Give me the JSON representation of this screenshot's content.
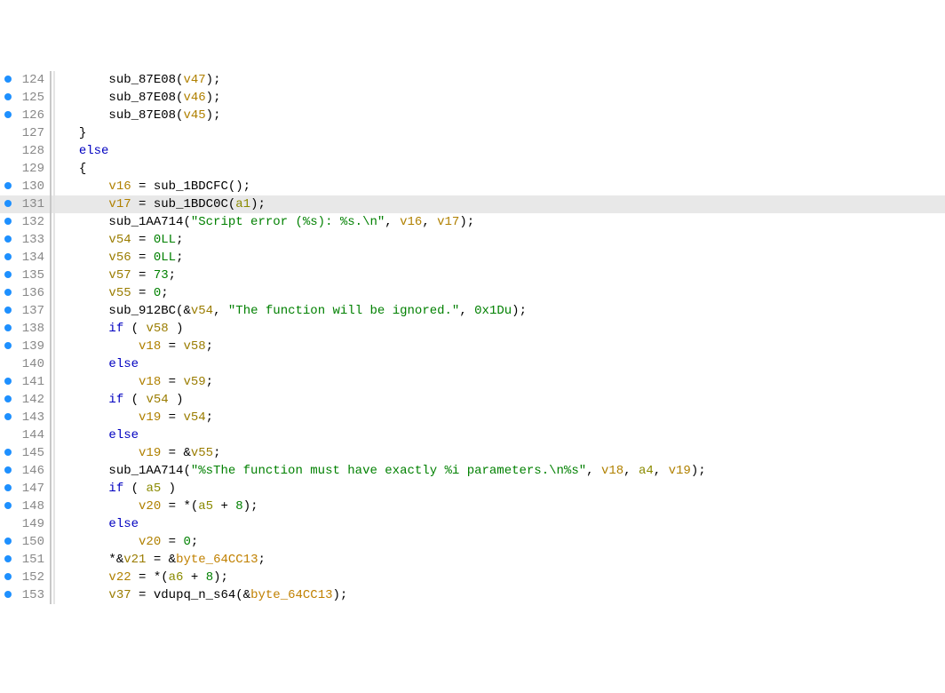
{
  "lines": [
    {
      "n": 124,
      "bp": true,
      "indent": 3,
      "tokens": [
        {
          "t": "sub_87E08",
          "c": "fn"
        },
        {
          "t": "("
        },
        {
          "t": "v47",
          "c": "var2"
        },
        {
          "t": ");"
        }
      ]
    },
    {
      "n": 125,
      "bp": true,
      "indent": 3,
      "tokens": [
        {
          "t": "sub_87E08",
          "c": "fn"
        },
        {
          "t": "("
        },
        {
          "t": "v46",
          "c": "var2"
        },
        {
          "t": ");"
        }
      ]
    },
    {
      "n": 126,
      "bp": true,
      "indent": 3,
      "tokens": [
        {
          "t": "sub_87E08",
          "c": "fn"
        },
        {
          "t": "("
        },
        {
          "t": "v45",
          "c": "var2"
        },
        {
          "t": ");"
        }
      ]
    },
    {
      "n": 127,
      "bp": false,
      "indent": 1,
      "tokens": [
        {
          "t": "}"
        }
      ]
    },
    {
      "n": 128,
      "bp": false,
      "indent": 1,
      "tokens": [
        {
          "t": "else",
          "c": "kw"
        }
      ]
    },
    {
      "n": 129,
      "bp": false,
      "indent": 1,
      "tokens": [
        {
          "t": "{"
        }
      ]
    },
    {
      "n": 130,
      "bp": true,
      "indent": 3,
      "tokens": [
        {
          "t": "v16",
          "c": "var2"
        },
        {
          "t": " = "
        },
        {
          "t": "sub_1BDCFC",
          "c": "fn"
        },
        {
          "t": "();"
        }
      ]
    },
    {
      "n": 131,
      "bp": true,
      "indent": 3,
      "hl": true,
      "tokens": [
        {
          "t": "v17",
          "c": "var2"
        },
        {
          "t": " = "
        },
        {
          "t": "sub_1BDC0C",
          "c": "fn"
        },
        {
          "t": "("
        },
        {
          "t": "a1",
          "c": "param"
        },
        {
          "t": ");"
        }
      ]
    },
    {
      "n": 132,
      "bp": true,
      "indent": 3,
      "tokens": [
        {
          "t": "sub_1AA714",
          "c": "fn"
        },
        {
          "t": "("
        },
        {
          "t": "\"Script error (%s): %s.\\n\"",
          "c": "str"
        },
        {
          "t": ", "
        },
        {
          "t": "v16",
          "c": "var2"
        },
        {
          "t": ", "
        },
        {
          "t": "v17",
          "c": "var2"
        },
        {
          "t": ");"
        }
      ]
    },
    {
      "n": 133,
      "bp": true,
      "indent": 3,
      "tokens": [
        {
          "t": "v54",
          "c": "var"
        },
        {
          "t": " = "
        },
        {
          "t": "0LL",
          "c": "num"
        },
        {
          "t": ";"
        }
      ]
    },
    {
      "n": 134,
      "bp": true,
      "indent": 3,
      "tokens": [
        {
          "t": "v56",
          "c": "var"
        },
        {
          "t": " = "
        },
        {
          "t": "0LL",
          "c": "num"
        },
        {
          "t": ";"
        }
      ]
    },
    {
      "n": 135,
      "bp": true,
      "indent": 3,
      "tokens": [
        {
          "t": "v57",
          "c": "var"
        },
        {
          "t": " = "
        },
        {
          "t": "73",
          "c": "num"
        },
        {
          "t": ";"
        }
      ]
    },
    {
      "n": 136,
      "bp": true,
      "indent": 3,
      "tokens": [
        {
          "t": "v55",
          "c": "var"
        },
        {
          "t": " = "
        },
        {
          "t": "0",
          "c": "num"
        },
        {
          "t": ";"
        }
      ]
    },
    {
      "n": 137,
      "bp": true,
      "indent": 3,
      "tokens": [
        {
          "t": "sub_912BC",
          "c": "fn"
        },
        {
          "t": "(&"
        },
        {
          "t": "v54",
          "c": "var"
        },
        {
          "t": ", "
        },
        {
          "t": "\"The function will be ignored.\"",
          "c": "str"
        },
        {
          "t": ", "
        },
        {
          "t": "0x1Du",
          "c": "num"
        },
        {
          "t": ");"
        }
      ]
    },
    {
      "n": 138,
      "bp": true,
      "indent": 3,
      "tokens": [
        {
          "t": "if",
          "c": "kw"
        },
        {
          "t": " ( "
        },
        {
          "t": "v58",
          "c": "var"
        },
        {
          "t": " )"
        }
      ]
    },
    {
      "n": 139,
      "bp": true,
      "indent": 5,
      "tokens": [
        {
          "t": "v18",
          "c": "var2"
        },
        {
          "t": " = "
        },
        {
          "t": "v58",
          "c": "var"
        },
        {
          "t": ";"
        }
      ]
    },
    {
      "n": 140,
      "bp": false,
      "indent": 3,
      "tokens": [
        {
          "t": "else",
          "c": "kw"
        }
      ]
    },
    {
      "n": 141,
      "bp": true,
      "indent": 5,
      "tokens": [
        {
          "t": "v18",
          "c": "var2"
        },
        {
          "t": " = "
        },
        {
          "t": "v59",
          "c": "var"
        },
        {
          "t": ";"
        }
      ]
    },
    {
      "n": 142,
      "bp": true,
      "indent": 3,
      "tokens": [
        {
          "t": "if",
          "c": "kw"
        },
        {
          "t": " ( "
        },
        {
          "t": "v54",
          "c": "var"
        },
        {
          "t": " )"
        }
      ]
    },
    {
      "n": 143,
      "bp": true,
      "indent": 5,
      "tokens": [
        {
          "t": "v19",
          "c": "var2"
        },
        {
          "t": " = "
        },
        {
          "t": "v54",
          "c": "var"
        },
        {
          "t": ";"
        }
      ]
    },
    {
      "n": 144,
      "bp": false,
      "indent": 3,
      "tokens": [
        {
          "t": "else",
          "c": "kw"
        }
      ]
    },
    {
      "n": 145,
      "bp": true,
      "indent": 5,
      "tokens": [
        {
          "t": "v19",
          "c": "var2"
        },
        {
          "t": " = &"
        },
        {
          "t": "v55",
          "c": "var"
        },
        {
          "t": ";"
        }
      ]
    },
    {
      "n": 146,
      "bp": true,
      "indent": 3,
      "tokens": [
        {
          "t": "sub_1AA714",
          "c": "fn"
        },
        {
          "t": "("
        },
        {
          "t": "\"%sThe function must have exactly %i parameters.\\n%s\"",
          "c": "str"
        },
        {
          "t": ", "
        },
        {
          "t": "v18",
          "c": "var2"
        },
        {
          "t": ", "
        },
        {
          "t": "a4",
          "c": "param"
        },
        {
          "t": ", "
        },
        {
          "t": "v19",
          "c": "var2"
        },
        {
          "t": ");"
        }
      ]
    },
    {
      "n": 147,
      "bp": true,
      "indent": 3,
      "tokens": [
        {
          "t": "if",
          "c": "kw"
        },
        {
          "t": " ( "
        },
        {
          "t": "a5",
          "c": "param"
        },
        {
          "t": " )"
        }
      ]
    },
    {
      "n": 148,
      "bp": true,
      "indent": 5,
      "tokens": [
        {
          "t": "v20",
          "c": "var2"
        },
        {
          "t": " = *("
        },
        {
          "t": "a5",
          "c": "param"
        },
        {
          "t": " + "
        },
        {
          "t": "8",
          "c": "num"
        },
        {
          "t": ");"
        }
      ]
    },
    {
      "n": 149,
      "bp": false,
      "indent": 3,
      "tokens": [
        {
          "t": "else",
          "c": "kw"
        }
      ]
    },
    {
      "n": 150,
      "bp": true,
      "indent": 5,
      "tokens": [
        {
          "t": "v20",
          "c": "var2"
        },
        {
          "t": " = "
        },
        {
          "t": "0",
          "c": "num"
        },
        {
          "t": ";"
        }
      ]
    },
    {
      "n": 151,
      "bp": true,
      "indent": 3,
      "tokens": [
        {
          "t": "*&"
        },
        {
          "t": "v21",
          "c": "var"
        },
        {
          "t": " = &"
        },
        {
          "t": "byte_64CC13",
          "c": "glob"
        },
        {
          "t": ";"
        }
      ]
    },
    {
      "n": 152,
      "bp": true,
      "indent": 3,
      "tokens": [
        {
          "t": "v22",
          "c": "var2"
        },
        {
          "t": " = *("
        },
        {
          "t": "a6",
          "c": "param"
        },
        {
          "t": " + "
        },
        {
          "t": "8",
          "c": "num"
        },
        {
          "t": ");"
        }
      ]
    },
    {
      "n": 153,
      "bp": true,
      "indent": 3,
      "tokens": [
        {
          "t": "v37",
          "c": "var"
        },
        {
          "t": " = "
        },
        {
          "t": "vdupq_n_s64",
          "c": "fn"
        },
        {
          "t": "(&"
        },
        {
          "t": "byte_64CC13",
          "c": "glob"
        },
        {
          "t": ");"
        }
      ]
    }
  ]
}
